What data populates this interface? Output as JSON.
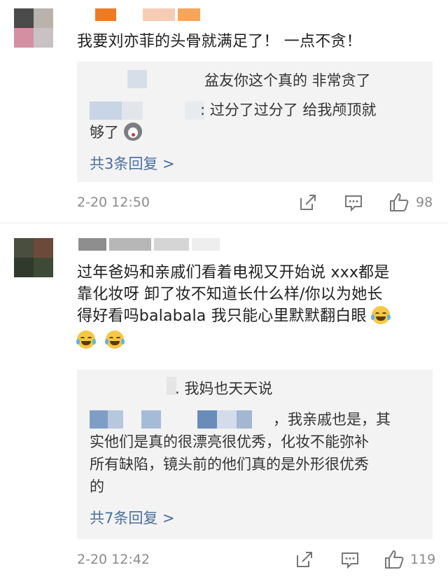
{
  "comments": [
    {
      "text": "我要刘亦菲的头骨就满足了！ 一点不贪！",
      "replies": [
        {
          "text": "盆友你这个真的 非常贪了"
        },
        {
          "text_1": ": 过分了过分了 给我颅顶就",
          "text_2": "够了",
          "emoji": "husky-icon"
        }
      ],
      "more_replies": "共3条回复 >",
      "time": "2-20 12:50",
      "likes": "98"
    },
    {
      "text_lines": [
        "过年爸妈和亲戚们看着电视又开始说 xxx都是",
        "靠化妆呀 卸了妆不知道长什么样/你以为她长",
        "得好看吗balabala 我只能心里默默翻白眼"
      ],
      "replies": [
        {
          "text": ". 我妈也天天说"
        },
        {
          "lines": [
            "，我亲戚也是，其",
            "实他们是真的很漂亮很优秀，化妆不能弥补",
            "所有缺陷，镜头前的他们真的是外形很优秀",
            "的"
          ]
        }
      ],
      "more_replies": "共7条回复 >",
      "time": "2-20 12:42",
      "likes": "119"
    }
  ],
  "colors": {
    "link": "#4a6fa0",
    "meta": "#8b8b8b",
    "reply_bg": "#f3f3f3"
  }
}
